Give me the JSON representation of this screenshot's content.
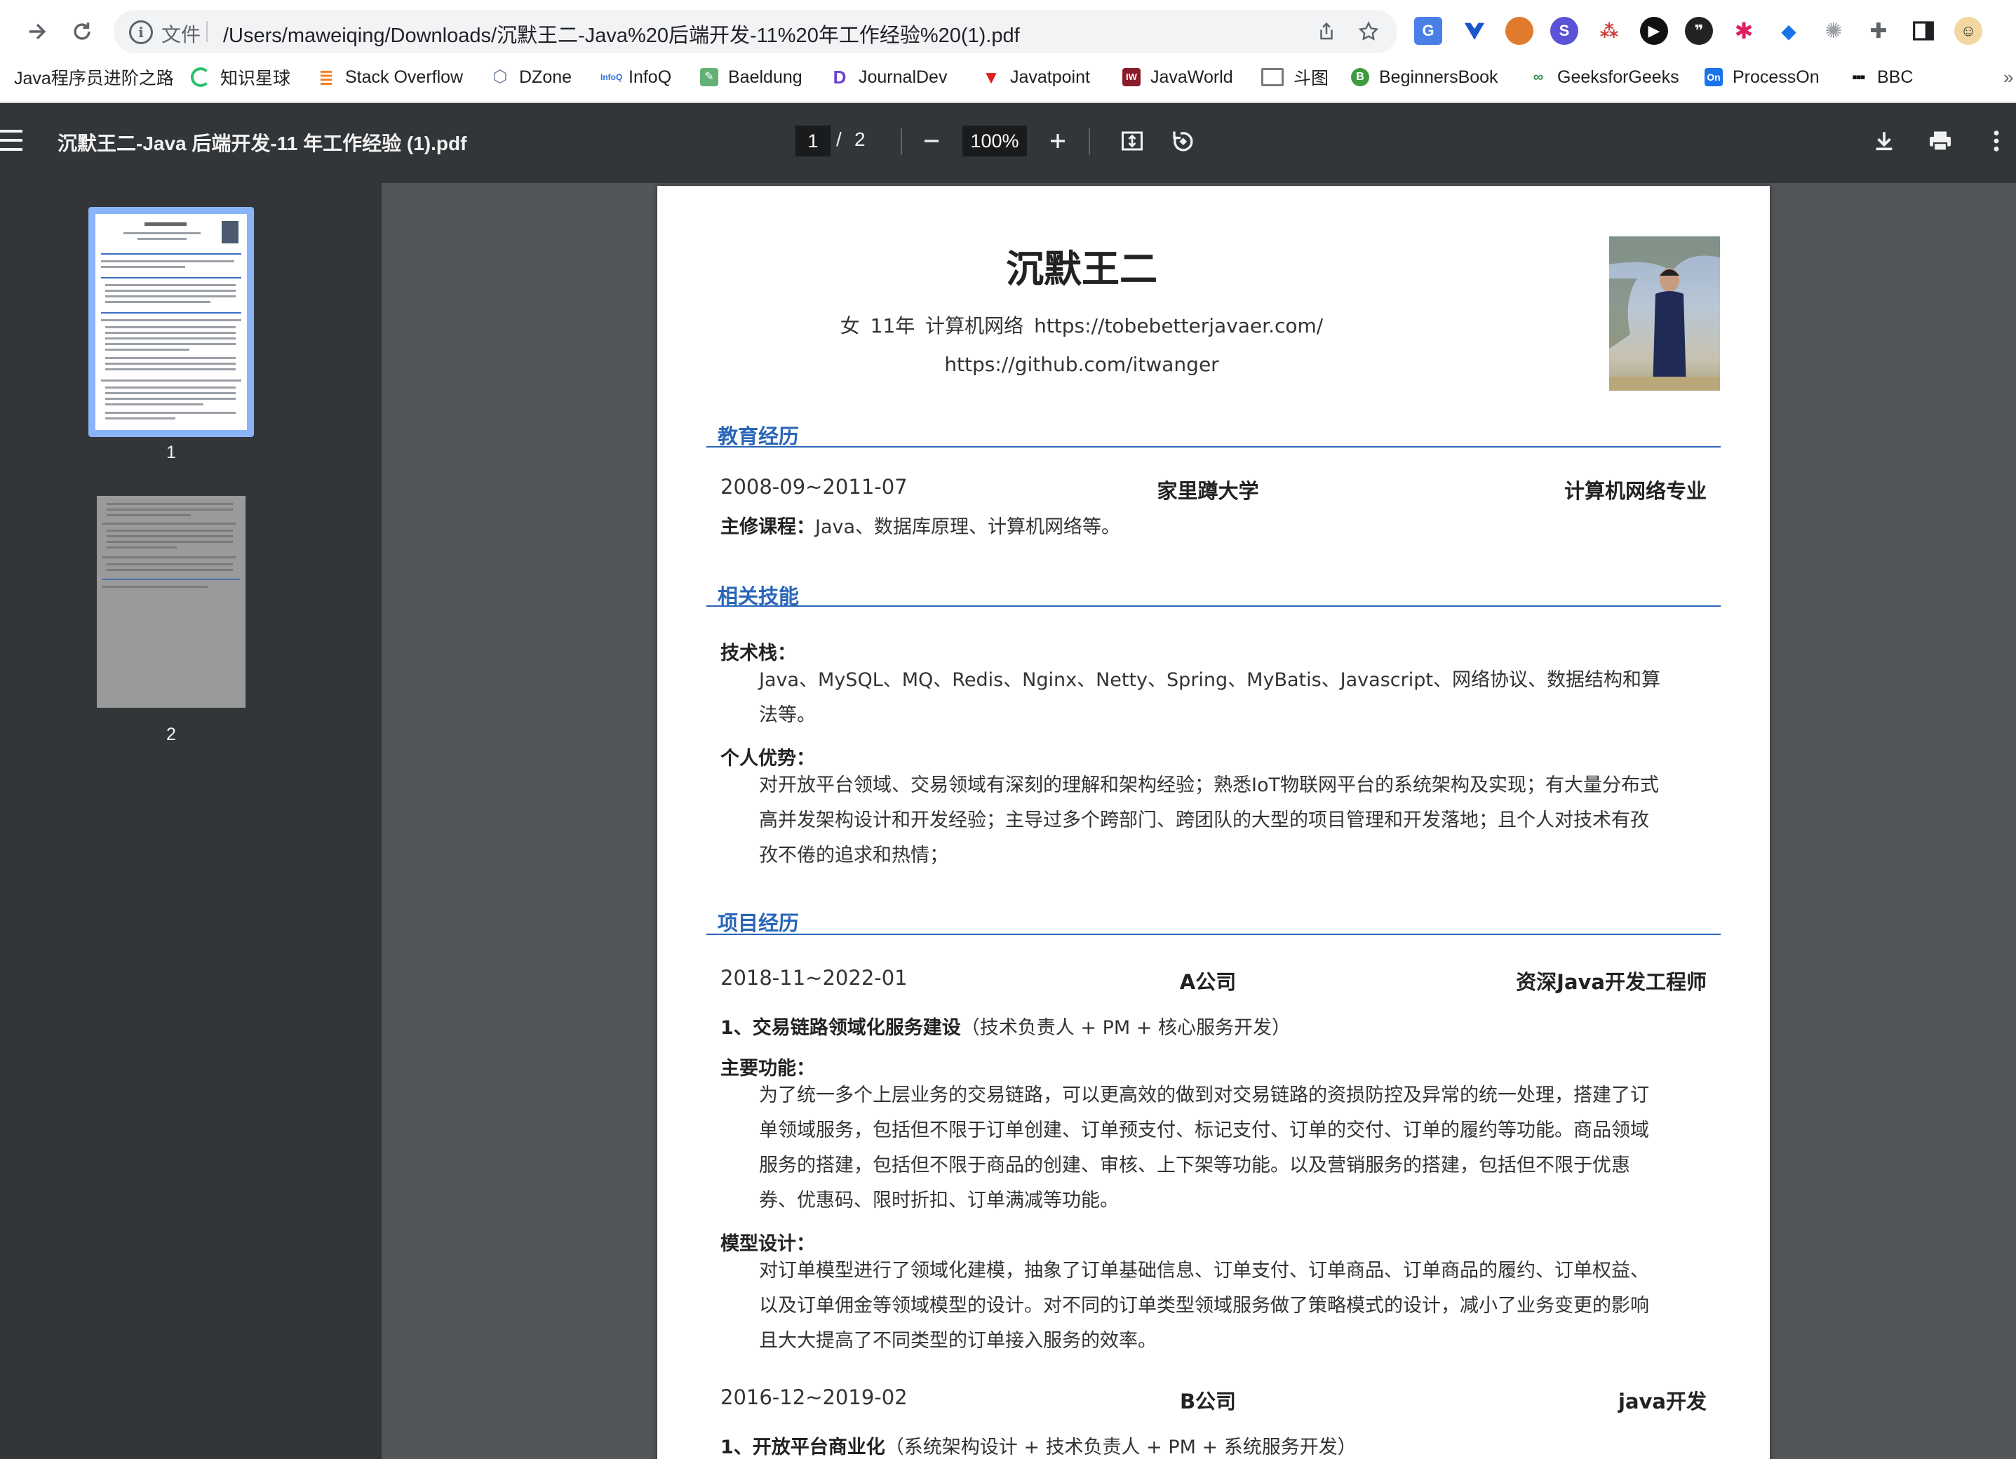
{
  "browser": {
    "scheme_label": "文件",
    "url": "/Users/maweiqing/Downloads/沉默王二-Java%20后端开发-11%20年工作经验%20(1).pdf",
    "bookmarks": [
      {
        "label": "Java程序员进阶之路",
        "icon": "java-icon",
        "color": "#e8710a"
      },
      {
        "label": "知识星球",
        "icon": "zsxq-icon",
        "color": "#27c26a"
      },
      {
        "label": "Stack Overflow",
        "icon": "stackoverflow-icon",
        "color": "#f48024"
      },
      {
        "label": "DZone",
        "icon": "dzone-icon",
        "color": "#6b7a99"
      },
      {
        "label": "InfoQ",
        "icon": "infoq-icon",
        "color": "#2e6fd8"
      },
      {
        "label": "Baeldung",
        "icon": "baeldung-icon",
        "color": "#63b175"
      },
      {
        "label": "JournalDev",
        "icon": "journaldev-icon",
        "color": "#6a3fd3"
      },
      {
        "label": "Javatpoint",
        "icon": "javatpoint-icon",
        "color": "#e02020"
      },
      {
        "label": "JavaWorld",
        "icon": "javaworld-icon",
        "color": "#8a1b2a"
      },
      {
        "label": "斗图",
        "icon": "folder-icon",
        "color": "#8a8a8a"
      },
      {
        "label": "BeginnersBook",
        "icon": "beginnersbook-icon",
        "color": "#3f9b3f"
      },
      {
        "label": "GeeksforGeeks",
        "icon": "geeksforgeeks-icon",
        "color": "#2f8d46"
      },
      {
        "label": "ProcessOn",
        "icon": "processon-icon",
        "color": "#1a73e8"
      },
      {
        "label": "BBC",
        "icon": "bbc-icon",
        "color": "#111111"
      }
    ]
  },
  "viewer": {
    "title": "沉默王二-Java 后端开发-11 年工作经验 (1).pdf",
    "current_page": "1",
    "page_separator": "/",
    "total_pages": "2",
    "zoom": "100%",
    "thumbnails": [
      {
        "label": "1"
      },
      {
        "label": "2"
      }
    ]
  },
  "resume": {
    "name": "沉默王二",
    "personal_info": "女 11年 计算机网络 https://tobebetterjavaer.com/",
    "github": "https://github.com/itwanger",
    "sections": {
      "education": "教育经历",
      "skills": "相关技能",
      "projects": "项目经历"
    },
    "education": {
      "period": "2008-09~2011-07",
      "school": "家里蹲大学",
      "major": "计算机网络专业",
      "courses_label": "主修课程：",
      "courses": "Java、数据库原理、计算机网络等。"
    },
    "skills": {
      "stack_label": "技术栈：",
      "stack": "Java、MySQL、MQ、Redis、Nginx、Netty、Spring、MyBatis、Javascript、网络协议、数据结构和算法等。",
      "advantage_label": "个人优势：",
      "advantage": "对开放平台领域、交易领域有深刻的理解和架构经验；熟悉IoT物联网平台的系统架构及实现；有大量分布式高并发架构设计和开发经验；主导过多个跨部门、跨团队的大型的项目管理和开发落地；且个人对技术有孜孜不倦的追求和热情；"
    },
    "jobs": [
      {
        "period": "2018-11~2022-01",
        "company": "A公司",
        "title": "资深Java开发工程师",
        "project_title": "1、交易链路领域化服务建设",
        "project_role": "（技术负责人 + PM + 核心服务开发）",
        "function_label": "主要功能：",
        "function": "为了统一多个上层业务的交易链路，可以更高效的做到对交易链路的资损防控及异常的统一处理，搭建了订单领域服务，包括但不限于订单创建、订单预支付、标记支付、订单的交付、订单的履约等功能。商品领域服务的搭建，包括但不限于商品的创建、审核、上下架等功能。以及营销服务的搭建，包括但不限于优惠券、优惠码、限时折扣、订单满减等功能。",
        "model_label": "模型设计：",
        "model": "对订单模型进行了领域化建模，抽象了订单基础信息、订单支付、订单商品、订单商品的履约、订单权益、以及订单佣金等领域模型的设计。对不同的订单类型领域服务做了策略模式的设计，减小了业务变更的影响且大大提高了不同类型的订单接入服务的效率。"
      },
      {
        "period": "2016-12~2019-02",
        "company": "B公司",
        "title": "java开发",
        "project_title": "1、开放平台商业化",
        "project_role": "（系统架构设计 + 技术负责人 + PM + 系统服务开发）"
      }
    ]
  }
}
